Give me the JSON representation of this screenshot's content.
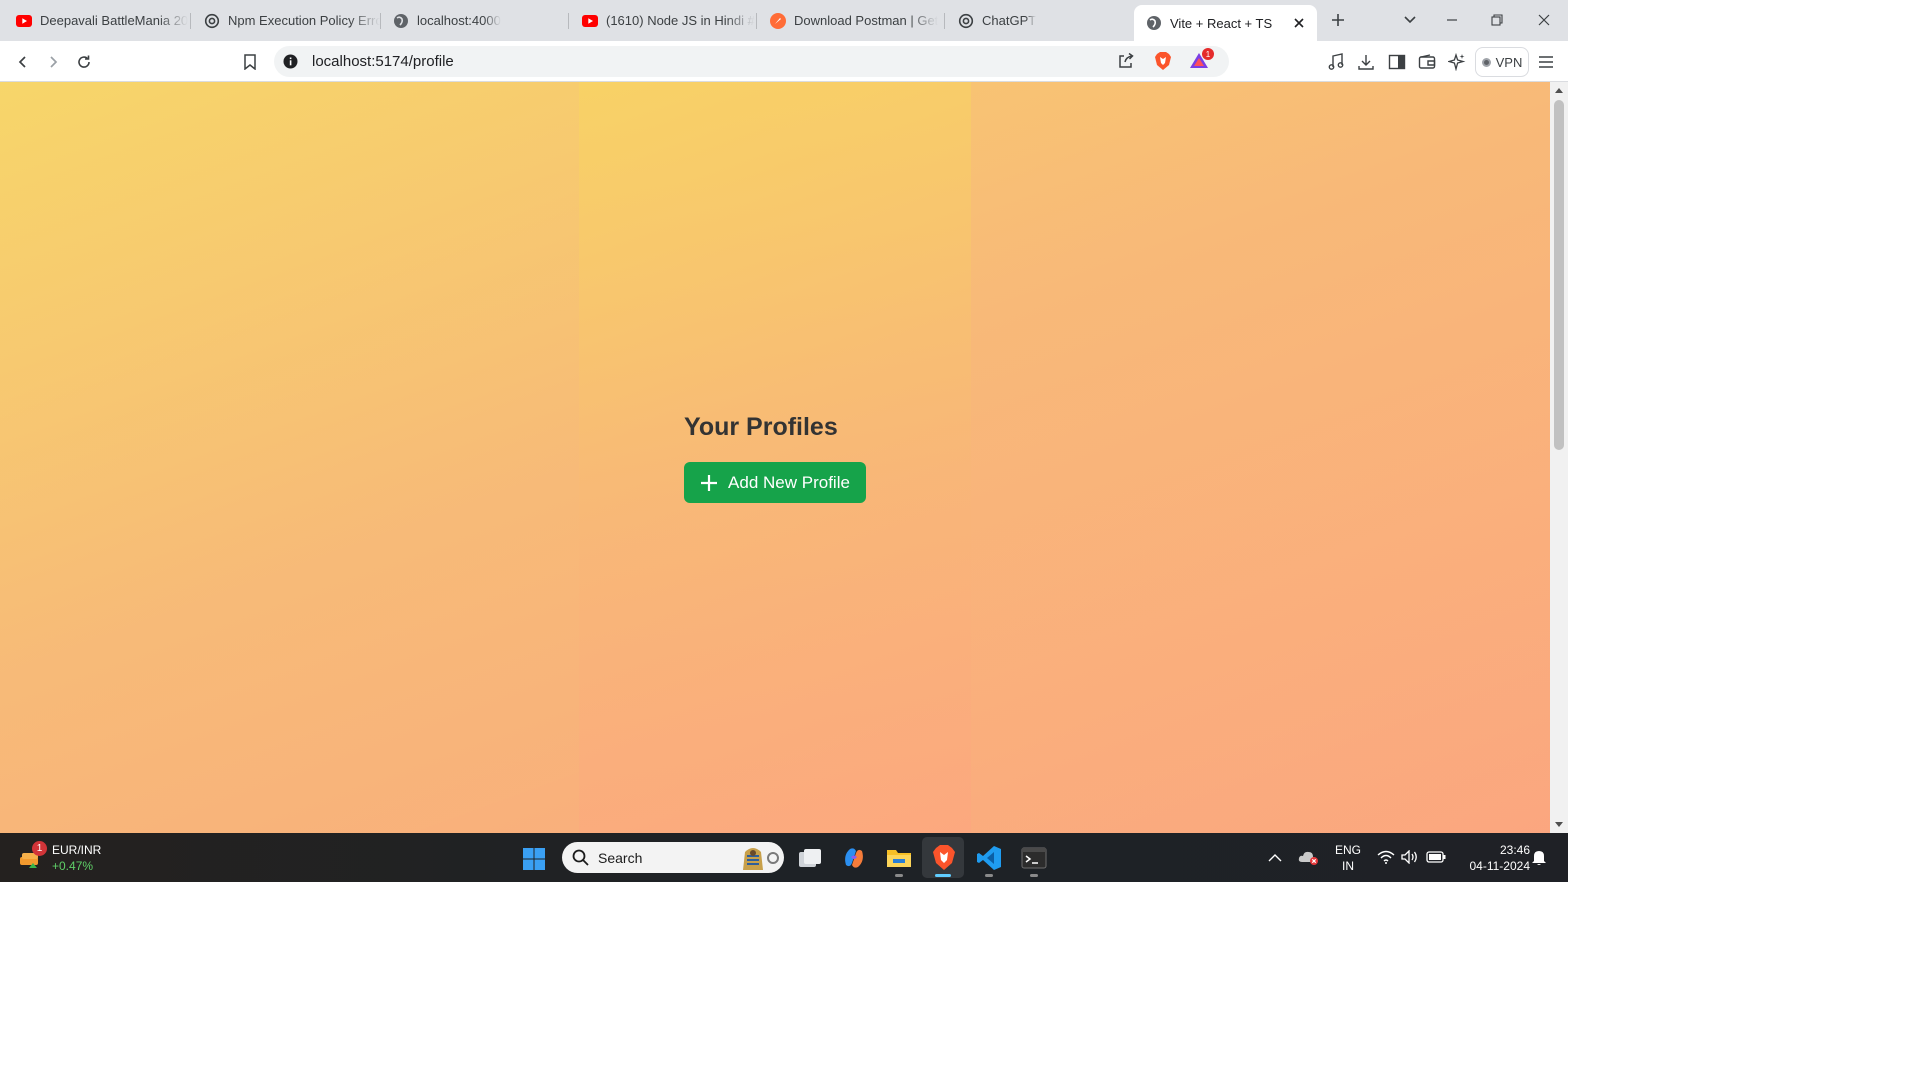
{
  "browser": {
    "tabs": [
      {
        "title": "Deepavali BattleMania 20",
        "icon": "youtube-icon"
      },
      {
        "title": "Npm Execution Policy Erro",
        "icon": "chatgpt-icon"
      },
      {
        "title": "localhost:4000",
        "icon": "globe-icon"
      },
      {
        "title": "(1610) Node JS in Hindi #",
        "icon": "youtube-icon"
      },
      {
        "title": "Download Postman | Get",
        "icon": "postman-icon"
      },
      {
        "title": "ChatGPT",
        "icon": "chatgpt-icon"
      },
      {
        "title": "Vite + React + TS",
        "icon": "globe-icon",
        "active": true
      }
    ],
    "url": "localhost:5174/profile",
    "brave_rewards_badge": "1",
    "vpn_label": "VPN"
  },
  "page": {
    "title": "Your Profiles",
    "add_button_label": "Add New Profile"
  },
  "taskbar": {
    "widget": {
      "pair": "EUR/INR",
      "change": "+0.47%",
      "badge": "1"
    },
    "search_placeholder": "Search",
    "language": {
      "line1": "ENG",
      "line2": "IN"
    },
    "clock": {
      "time": "23:46",
      "date": "04-11-2024"
    }
  },
  "colors": {
    "primary_button": "#16a34a",
    "heading": "#333333",
    "gradient_start": "#f6d569",
    "gradient_end": "#fba77f"
  }
}
